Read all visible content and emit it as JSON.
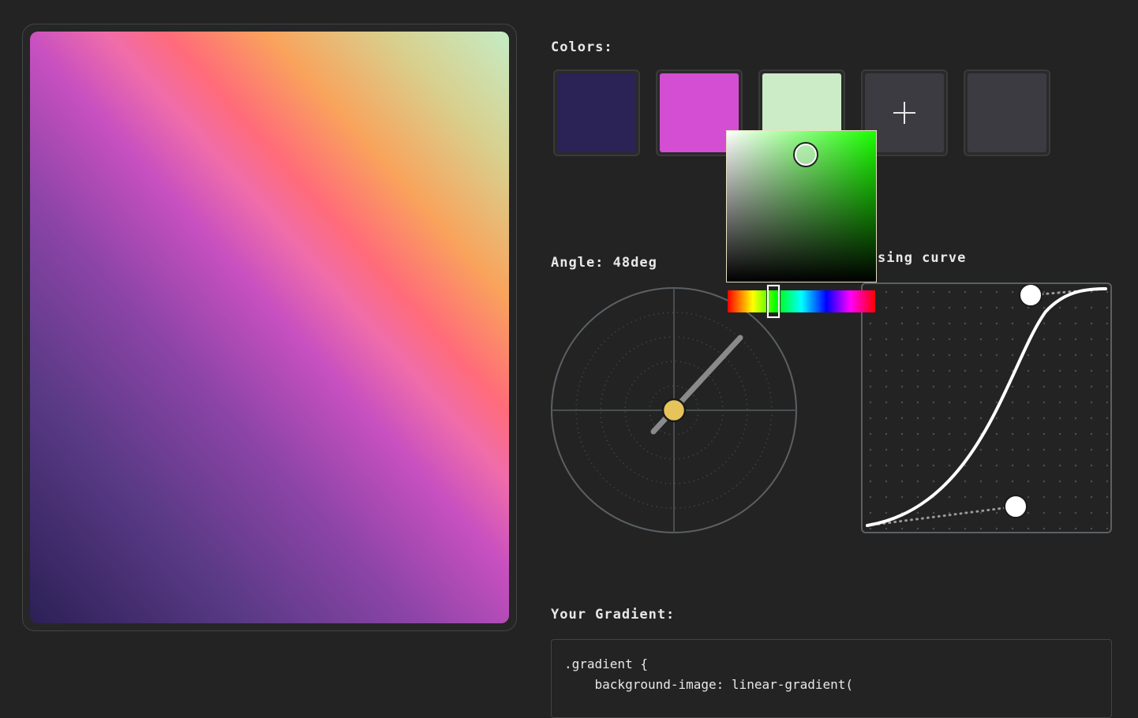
{
  "colors": {
    "label": "Colors:",
    "swatches": [
      {
        "color": "#2b2255"
      },
      {
        "color": "#d44ed4"
      },
      {
        "color": "#ccecc8"
      }
    ],
    "add_label": "+"
  },
  "angle": {
    "label": "Angle: 48deg",
    "value": 48
  },
  "easing": {
    "label": "Easing curve",
    "visible_label": "sing curve"
  },
  "picker": {
    "hue_color": "#1aff00",
    "selected_color": "#ccecc8"
  },
  "gradient": {
    "label": "Your Gradient:",
    "code_line_1": ".gradient {",
    "code_line_2": "    background-image: linear-gradient("
  },
  "palette": {
    "accent_handle": "#e6c45a",
    "panel_border": "#5b6064"
  }
}
